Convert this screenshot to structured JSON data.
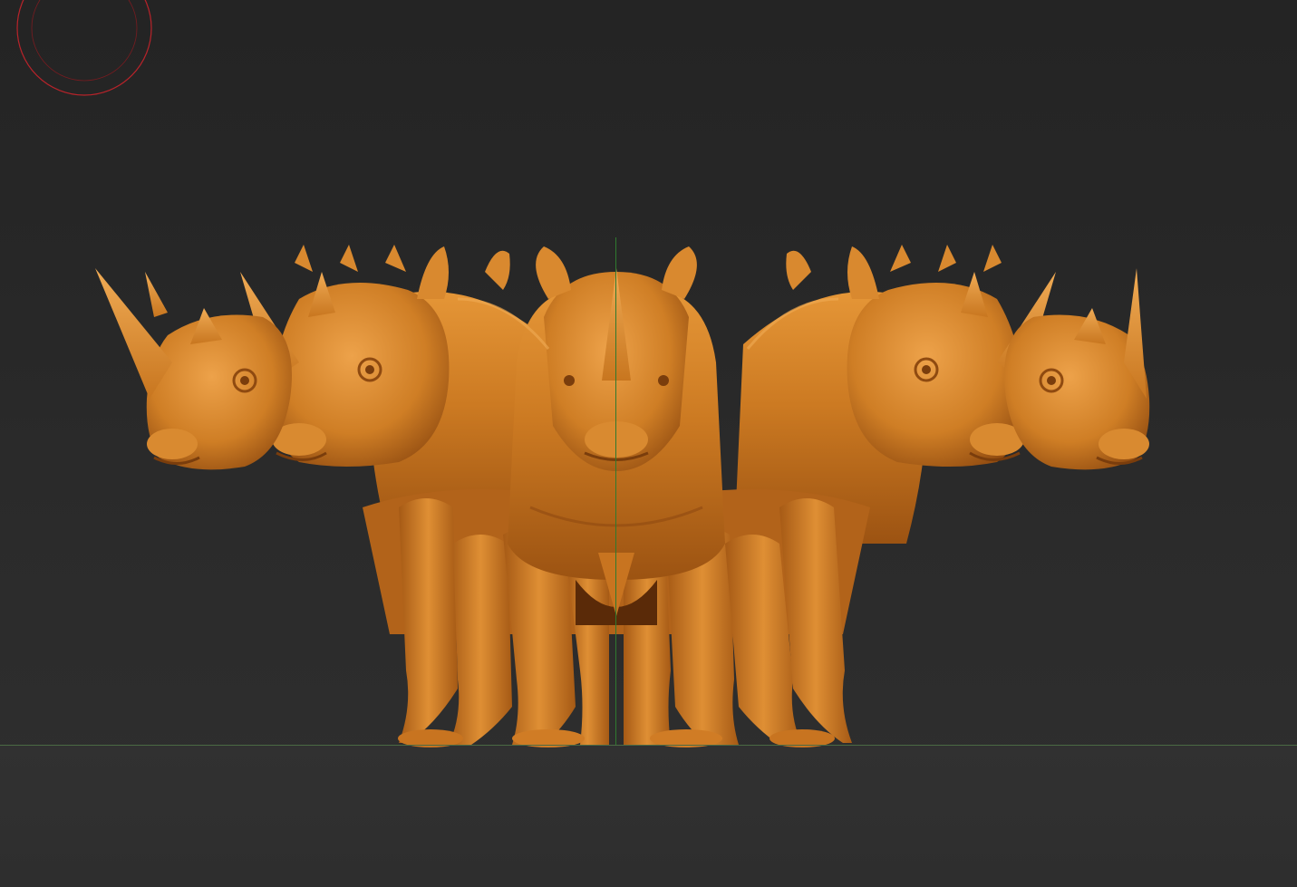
{
  "viewport": {
    "background_color": "#2b2b2b",
    "floor_color": "#2f2f2f",
    "model_color": "#c9771f",
    "model_highlight": "#e89a3c",
    "model_shadow": "#7a3d0c",
    "axis_y_color": "#2f7a2f",
    "gizmo_color": "#b8232a"
  },
  "icons": {
    "navigation_gizmo": "navigation-gizmo-icon"
  },
  "scene": {
    "model_count": 5
  }
}
